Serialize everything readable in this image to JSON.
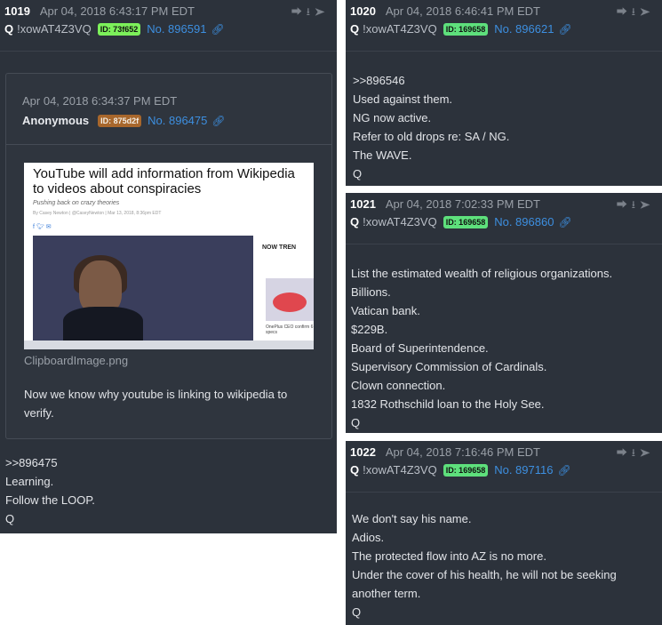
{
  "posts": [
    {
      "num": "1019",
      "date": "Apr 04, 2018 6:43:17 PM EDT",
      "q": "Q",
      "tripcode": "!xowAT4Z3VQ",
      "id": "ID: 73f652",
      "postno": "No. 896591",
      "quote": {
        "date": "Apr 04, 2018 6:34:37 PM EDT",
        "author": "Anonymous",
        "id": "ID: 875d2f",
        "postno": "No. 896475",
        "image": {
          "headline": "YouTube will add information from Wikipedia to videos about conspiracies",
          "subhead": "Pushing back on crazy theories",
          "byline": "By Casey Newton | @CaseyNewton | Mar 13, 2018, 8:36pm EDT",
          "trending": "NOW TREN",
          "thumb_caption": "OnePlus CEO confirm 6 specs"
        },
        "filename": "ClipboardImage.png",
        "lines": [
          "Now we know why youtube is linking to wikipedia to verify."
        ]
      },
      "lines": [
        ">>896475",
        "Learning.",
        "Follow the LOOP.",
        "Q"
      ]
    },
    {
      "num": "1020",
      "date": "Apr 04, 2018 6:46:41 PM EDT",
      "q": "Q",
      "tripcode": "!xowAT4Z3VQ",
      "id": "ID: 169658",
      "postno": "No. 896621",
      "lines": [
        ">>896546",
        "Used against them.",
        "NG now active.",
        "Refer to old drops re: SA / NG.",
        "The WAVE.",
        "Q"
      ]
    },
    {
      "num": "1021",
      "date": "Apr 04, 2018 7:02:33 PM EDT",
      "q": "Q",
      "tripcode": "!xowAT4Z3VQ",
      "id": "ID: 169658",
      "postno": "No. 896860",
      "lines": [
        "List the estimated wealth of religious organizations.",
        "Billions.",
        "Vatican bank.",
        "$229B.",
        "Board of Superintendence.",
        "Supervisory Commission of Cardinals.",
        "Clown connection.",
        "1832 Rothschild loan to the Holy See.",
        "Q"
      ]
    },
    {
      "num": "1022",
      "date": "Apr 04, 2018 7:16:46 PM EDT",
      "q": "Q",
      "tripcode": "!xowAT4Z3VQ",
      "id": "ID: 169658",
      "postno": "No. 897116",
      "lines": [
        "We don't say his name.",
        "Adios.",
        "The protected flow into AZ is no more.",
        "Under the cover of his health, he will not be seeking another term.",
        "Q"
      ]
    }
  ],
  "icons": {
    "share": "share-icon",
    "download": "download-icon",
    "goto": "arrow-right-circle-icon",
    "link": "link-icon"
  },
  "colors": {
    "card_bg": "#2c323b",
    "post_number_link": "#3d8fe0",
    "id_badge_lime": "#7cf05a",
    "id_badge_green": "#5ee07c",
    "id_badge_brown": "#a8672c"
  }
}
